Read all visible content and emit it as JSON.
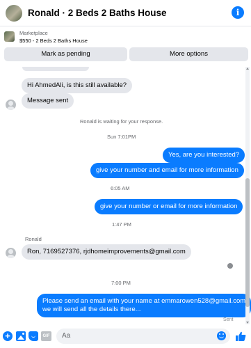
{
  "header": {
    "title": "Ronald · 2 Beds 2 Baths House",
    "info_icon": "info-icon"
  },
  "marketplace": {
    "label": "Marketplace",
    "item": "$550 - 2 Beds 2 Baths House",
    "buttons": {
      "pending": "Mark as pending",
      "more": "More options"
    }
  },
  "messages": {
    "m1": "Hi AhmedAli, is this still available?",
    "m2": "Message sent",
    "status": "Ronald is waiting for your response.",
    "t1": "Sun 7:01PM",
    "m3": "Yes, are you interested?",
    "m4": "give your number and email for more information",
    "t2": "6:05 AM",
    "m5": "give your number or email for more information",
    "t3": "1:47 PM",
    "sender": "Ronald",
    "m6": "Ron, 7169527376, rjdhomeimprovements@gmail.com",
    "t4": "7:00 PM",
    "m7_line1": "Please send an email with your name at emmarowen528@gmail.com",
    "m7_line2": "we will send all the details there...",
    "sent": "Sent"
  },
  "composer": {
    "placeholder": "Aa",
    "gif_label": "GIF"
  },
  "colors": {
    "accent": "#0a7cff",
    "incoming_bubble": "#e4e6eb",
    "timestamp": "#65676b"
  }
}
